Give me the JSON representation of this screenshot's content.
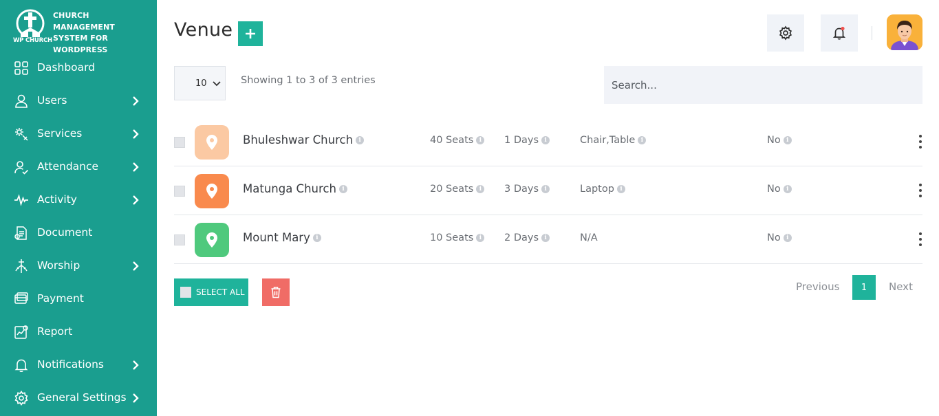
{
  "brand": {
    "logo_text": "WP CHURCH",
    "line1": "CHURCH MANAGEMENT",
    "line2": "SYSTEM FOR",
    "line3": "WORDPRESS"
  },
  "sidebar": {
    "items": [
      {
        "label": "Dashboard",
        "icon": "grid-icon",
        "has_submenu": false
      },
      {
        "label": "Users",
        "icon": "user-icon",
        "has_submenu": true
      },
      {
        "label": "Services",
        "icon": "services-icon",
        "has_submenu": true
      },
      {
        "label": "Attendance",
        "icon": "user-check-icon",
        "has_submenu": true
      },
      {
        "label": "Activity",
        "icon": "pulse-icon",
        "has_submenu": true
      },
      {
        "label": "Document",
        "icon": "document-icon",
        "has_submenu": false
      },
      {
        "label": "Worship",
        "icon": "worship-icon",
        "has_submenu": true
      },
      {
        "label": "Payment",
        "icon": "payment-icon",
        "has_submenu": false
      },
      {
        "label": "Report",
        "icon": "report-icon",
        "has_submenu": false
      },
      {
        "label": "Notifications",
        "icon": "bell-icon",
        "has_submenu": true
      },
      {
        "label": "General Settings",
        "icon": "gear-icon",
        "has_submenu": true
      }
    ]
  },
  "header": {
    "title": "Venue",
    "add_label": "+"
  },
  "controls": {
    "page_length": "10",
    "entries_info": "Showing 1 to 3 of 3 entries",
    "search_placeholder": "Search..."
  },
  "rows": [
    {
      "name": "Bhuleshwar Church",
      "seats": "40 Seats",
      "days": "1 Days",
      "equipment": "Chair,Table",
      "status": "No",
      "color": "#fbc9a3"
    },
    {
      "name": "Matunga Church",
      "seats": "20 Seats",
      "days": "3 Days",
      "equipment": "Laptop",
      "status": "No",
      "color": "#f98a4d"
    },
    {
      "name": "Mount Mary",
      "seats": "10 Seats",
      "days": "2 Days",
      "equipment": "N/A",
      "status": "No",
      "color": "#4fc97d"
    }
  ],
  "footer": {
    "select_all_label": "SELECT ALL",
    "prev_label": "Previous",
    "current_page": "1",
    "next_label": "Next"
  },
  "colors": {
    "sidebar": "#1a9e8f",
    "accent": "#1fb39b",
    "danger": "#f06c66",
    "bell_dot": "#f0524f"
  }
}
